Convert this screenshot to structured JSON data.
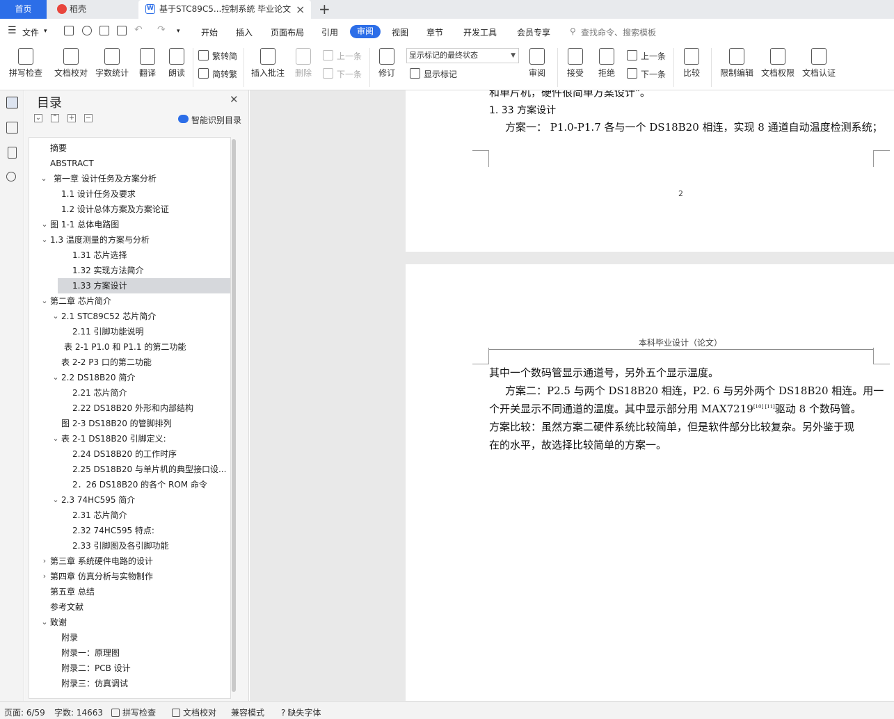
{
  "tabs": {
    "home": "首页",
    "daoke": "稻壳",
    "doc": "基于STC89C5...控制系统 毕业论文"
  },
  "menu": {
    "file": "文件",
    "items": [
      "开始",
      "插入",
      "页面布局",
      "引用",
      "审阅",
      "视图",
      "章节",
      "开发工具",
      "会员专享"
    ],
    "active": "审阅",
    "search_placeholder": "查找命令、搜索模板"
  },
  "ribbon": {
    "spell": "拼写检查",
    "proof": "文档校对",
    "count": "字数统计",
    "translate": "翻译",
    "read": "朗读",
    "trad": "繁转简",
    "simp": "简转繁",
    "add_comment": "插入批注",
    "delete": "删除",
    "prev": "上一条",
    "next": "下一条",
    "revise": "修订",
    "markup_state": "显示标记的最终状态",
    "show_markup": "显示标记",
    "review": "审阅",
    "accept": "接受",
    "reject": "拒绝",
    "prev2": "上一条",
    "next2": "下一条",
    "compare": "比较",
    "restrict": "限制编辑",
    "permission": "文档权限",
    "certify": "文档认证"
  },
  "toc": {
    "title": "目录",
    "smart": "智能识别目录",
    "items": [
      {
        "text": "摘要",
        "chev": ""
      },
      {
        "text": "ABSTRACT",
        "chev": ""
      },
      {
        "text": "第一章  设计任务及方案分析",
        "chev": "v"
      },
      {
        "text": "1.1  设计任务及要求",
        "chev": ""
      },
      {
        "text": "1.2  设计总体方案及方案论证",
        "chev": ""
      },
      {
        "text": "图 1-1  总体电路图",
        "chev": "v"
      },
      {
        "text": "1.3  温度测量的方案与分析",
        "chev": "v"
      },
      {
        "text": "1.31 芯片选择",
        "chev": ""
      },
      {
        "text": "1.32 实现方法简介",
        "chev": ""
      },
      {
        "text": "1.33  方案设计",
        "chev": ""
      },
      {
        "text": "第二章  芯片简介",
        "chev": "v"
      },
      {
        "text": "2.1 STC89C52 芯片简介",
        "chev": "v"
      },
      {
        "text": "2.11 引脚功能说明",
        "chev": ""
      },
      {
        "text": "表 2-1 P1.0 和 P1.1 的第二功能",
        "chev": ""
      },
      {
        "text": "表 2-2    P3 口的第二功能",
        "chev": ""
      },
      {
        "text": "2.2 DS18B20 简介",
        "chev": "v"
      },
      {
        "text": "2.21 芯片简介",
        "chev": ""
      },
      {
        "text": "2.22 DS18B20 外形和内部结构",
        "chev": ""
      },
      {
        "text": "图 2-3    DS18B20 的管脚排列",
        "chev": ""
      },
      {
        "text": "表 2-1    DS18B20 引脚定义:",
        "chev": "v"
      },
      {
        "text": "2.24    DS18B20 的工作时序",
        "chev": ""
      },
      {
        "text": "2.25 DS18B20 与单片机的典型接口设...",
        "chev": ""
      },
      {
        "text": "2．26 DS18B20 的各个 ROM 命令",
        "chev": ""
      },
      {
        "text": "2.3 74HC595 简介",
        "chev": "v"
      },
      {
        "text": "2.31 芯片简介",
        "chev": ""
      },
      {
        "text": "2.32    74HC595 特点:",
        "chev": ""
      },
      {
        "text": "2.33    引脚图及各引脚功能",
        "chev": ""
      },
      {
        "text": "第三章  系统硬件电路的设计",
        "chev": ">"
      },
      {
        "text": "第四章  仿真分析与实物制作",
        "chev": ">"
      },
      {
        "text": "第五章  总结",
        "chev": ""
      },
      {
        "text": "参考文献",
        "chev": ""
      },
      {
        "text": "致谢",
        "chev": "v"
      },
      {
        "text": "附录",
        "chev": ""
      },
      {
        "text": "附录一：原理图",
        "chev": ""
      },
      {
        "text": "附录二：PCB 设计",
        "chev": ""
      },
      {
        "text": "附录三：仿真调试",
        "chev": ""
      }
    ]
  },
  "doc": {
    "p1_top": "和单片机，硬件很简单方案设计\"。",
    "p1_heading": "1. 33  方案设计",
    "p1_line": "方案一： P1.0-P1.7 各与一个 DS18B20 相连，实现 8 通道自动温度检测系统；",
    "page_number": "2",
    "header": "本科毕业设计（论文）",
    "lines": [
      "其中一个数码管显示通道号，另外五个显示温度。",
      "方案二：P2.5 与两个 DS18B20 相连，P2. 6 与另外两个 DS18B20 相连。用一",
      "个开关显示不同通道的温度。其中显示部分用 MAX7219",
      "驱动 8 个数码管。",
      "方案比较：虽然方案二硬件系统比较简单，但是软件部分比较复杂。另外鉴于现",
      "在的水平，故选择比较简单的方案一。"
    ],
    "citation": "[10] [11]"
  },
  "status": {
    "page": "页面: 6/59",
    "words": "字数: 14663",
    "spell": "拼写检查",
    "proof": "文档校对",
    "compat": "兼容模式",
    "font": "缺失字体"
  }
}
